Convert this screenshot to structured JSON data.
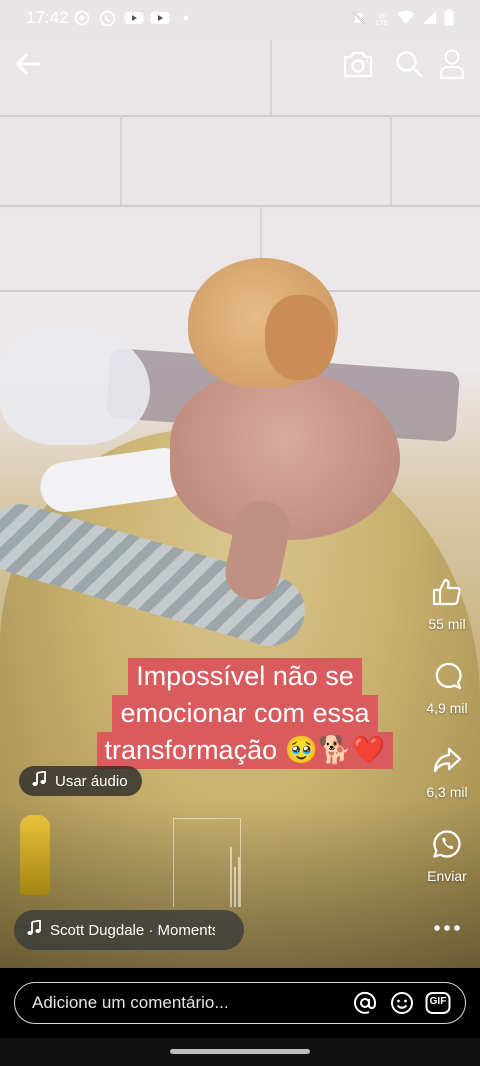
{
  "status_bar": {
    "time": "17:42",
    "left_icons": [
      "target-icon",
      "whatsapp-icon",
      "youtube-icon",
      "youtube-icon",
      "dot-icon"
    ],
    "right_icons": [
      "mute-icon",
      "volte-icon",
      "wifi-icon",
      "signal-icon",
      "battery-icon"
    ],
    "volte_label": "Vo LTE"
  },
  "top_bar": {
    "back_icon": "arrow-left-icon",
    "camera_icon": "camera-icon",
    "search_icon": "search-icon",
    "profile_icon": "person-icon"
  },
  "rail": {
    "like_count": "55 mil",
    "comment_count": "4,9 mil",
    "share_count": "6,3 mil",
    "whatsapp_label": "Enviar"
  },
  "caption": {
    "line1": "Impossível não se",
    "line2": "emocionar com essa",
    "line3": "transformação 🥹🐕❤️"
  },
  "audio": {
    "use_audio_label": "Usar áudio",
    "song_label": "Scott Dugdale · Moments"
  },
  "comment": {
    "placeholder": "Adicione um comentário...",
    "gif_label": "GIF"
  },
  "colors": {
    "caption_bg": "#d95b5e",
    "text": "#ffffff"
  }
}
